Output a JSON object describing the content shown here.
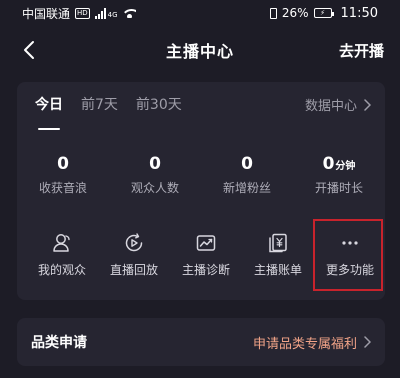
{
  "status_bar": {
    "carrier": "中国联通",
    "hd": "HD",
    "network": "4G",
    "battery": "26%",
    "time": "11:50"
  },
  "header": {
    "title": "主播中心",
    "action": "去开播"
  },
  "tabs": [
    {
      "label": "今日",
      "active": true
    },
    {
      "label": "前7天",
      "active": false
    },
    {
      "label": "前30天",
      "active": false
    }
  ],
  "data_center": "数据中心",
  "metrics": [
    {
      "value": "0",
      "unit": "",
      "label": "收获音浪"
    },
    {
      "value": "0",
      "unit": "",
      "label": "观众人数"
    },
    {
      "value": "0",
      "unit": "",
      "label": "新增粉丝"
    },
    {
      "value": "0",
      "unit": "分钟",
      "label": "开播时长"
    }
  ],
  "shortcuts": [
    {
      "label": "我的观众",
      "icon": "audience-icon"
    },
    {
      "label": "直播回放",
      "icon": "replay-icon"
    },
    {
      "label": "主播诊断",
      "icon": "diagnosis-icon"
    },
    {
      "label": "主播账单",
      "icon": "bill-icon"
    },
    {
      "label": "更多功能",
      "icon": "more-icon"
    }
  ],
  "category": {
    "title": "品类申请",
    "link": "申请品类专属福利"
  },
  "colors": {
    "background": "#1d1c26",
    "card": "#262531",
    "highlight_border": "#c8232c",
    "link": "#f2a488"
  }
}
